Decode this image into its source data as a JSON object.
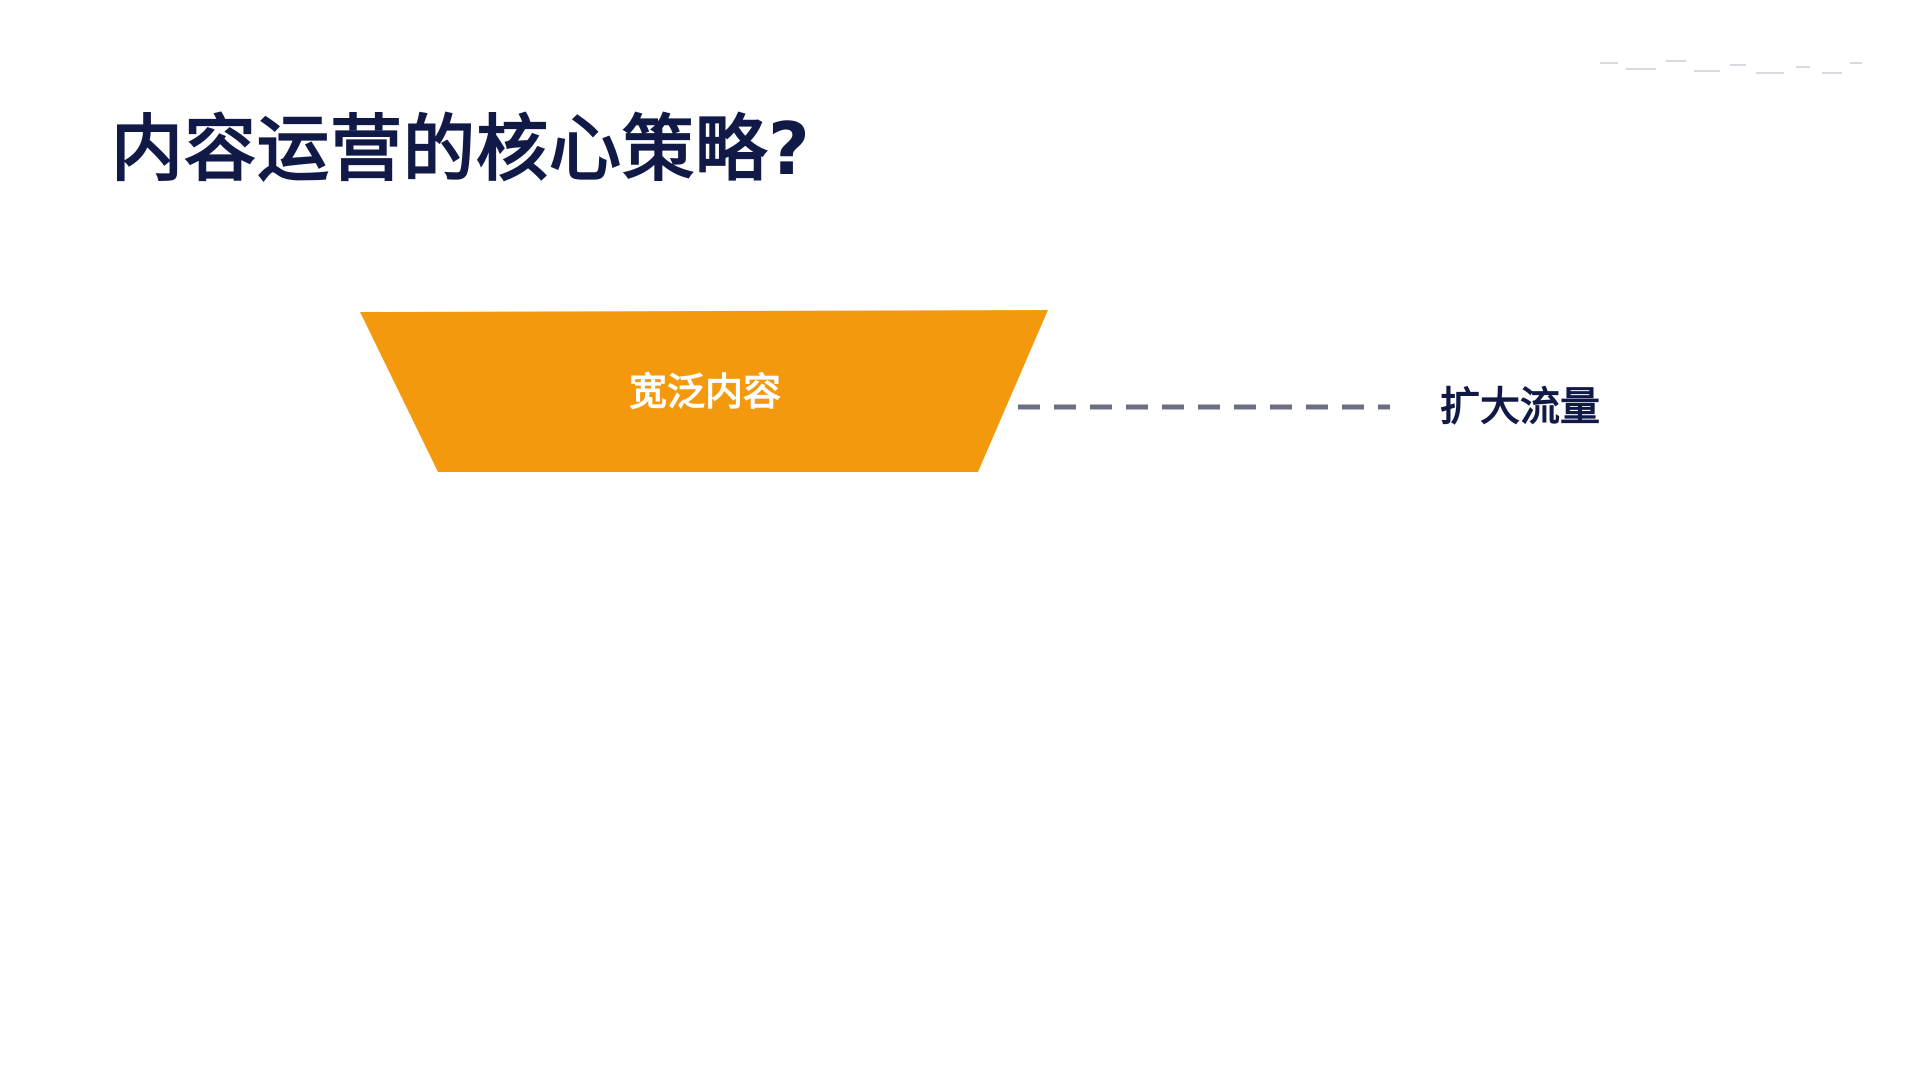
{
  "slide": {
    "title": "内容运营的核心策略?",
    "funnel_layers": [
      {
        "label": "宽泛内容",
        "side_label": "扩大流量",
        "fill_color": "#f4990e",
        "label_color": "#ffffff"
      }
    ],
    "connector_color": "#6b6f85",
    "title_color": "#111a47",
    "background_color": "#ffffff"
  }
}
